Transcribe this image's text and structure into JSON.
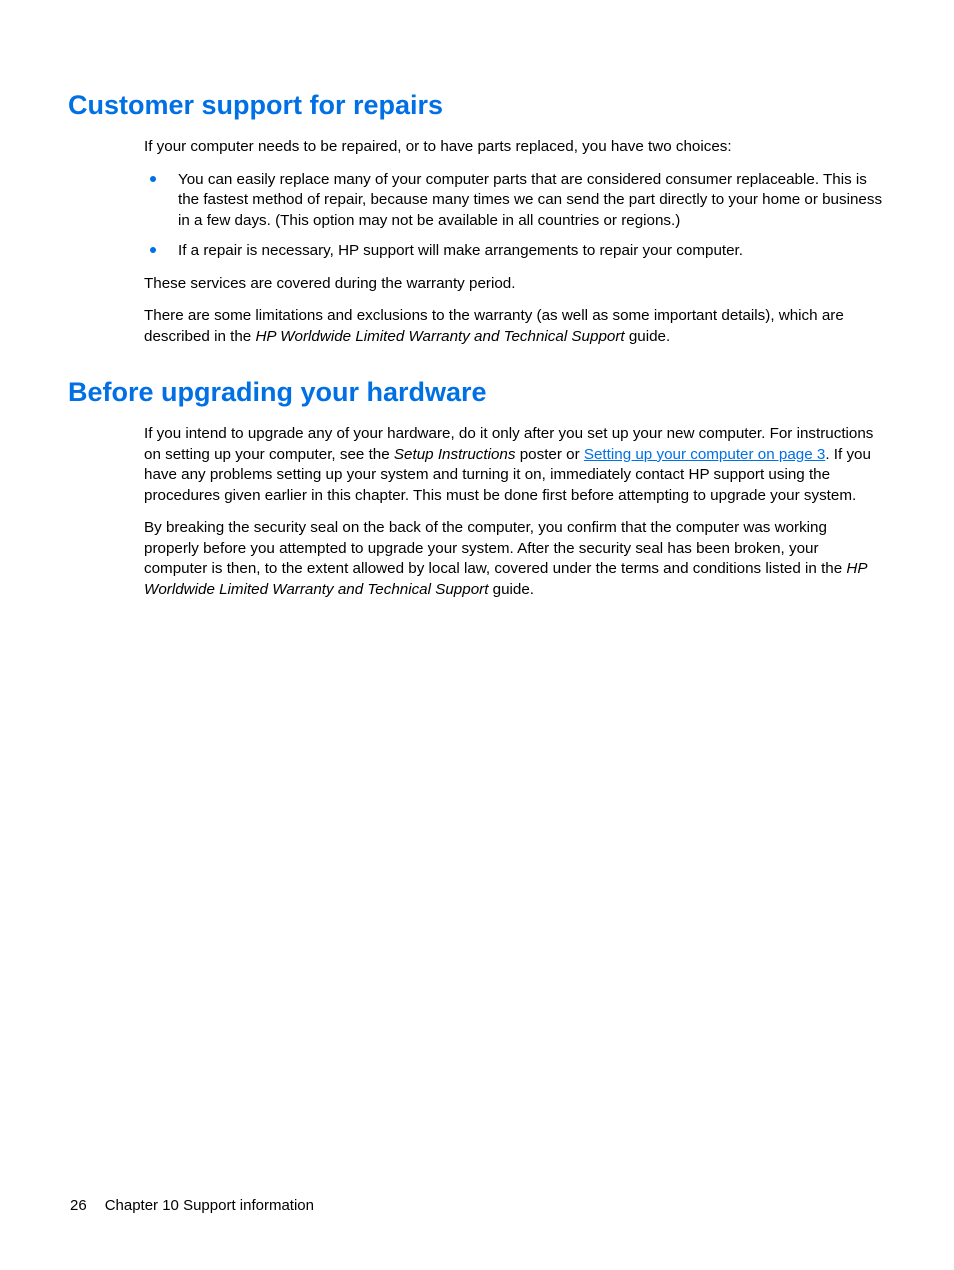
{
  "section1": {
    "heading": "Customer support for repairs",
    "intro": "If your computer needs to be repaired, or to have parts replaced, you have two choices:",
    "bullets": [
      "You can easily replace many of your computer parts that are considered consumer replaceable. This is the fastest method of repair, because many times we can send the part directly to your home or business in a few days. (This option may not be available in all countries or regions.)",
      "If a repair is necessary, HP support will make arrangements to repair your computer."
    ],
    "para2": "These services are covered during the warranty period.",
    "para3_a": "There are some limitations and exclusions to the warranty (as well as some important details), which are described in the ",
    "para3_em": "HP Worldwide Limited Warranty and Technical Support",
    "para3_b": " guide."
  },
  "section2": {
    "heading": "Before upgrading your hardware",
    "p1_a": "If you intend to upgrade any of your hardware, do it only after you set up your new computer. For instructions on setting up your computer, see the ",
    "p1_em": "Setup Instructions",
    "p1_b": " poster or ",
    "p1_link": "Setting up your computer on page 3",
    "p1_c": ". If you have any problems setting up your system and turning it on, immediately contact HP support using the procedures given earlier in this chapter. This must be done first before attempting to upgrade your system.",
    "p2_a": "By breaking the security seal on the back of the computer, you confirm that the computer was working properly before you attempted to upgrade your system. After the security seal has been broken, your computer is then, to the extent allowed by local law, covered under the terms and conditions listed in the ",
    "p2_em": "HP Worldwide Limited Warranty and Technical Support",
    "p2_b": " guide."
  },
  "footer": {
    "page": "26",
    "chapter": "Chapter 10   Support information"
  }
}
